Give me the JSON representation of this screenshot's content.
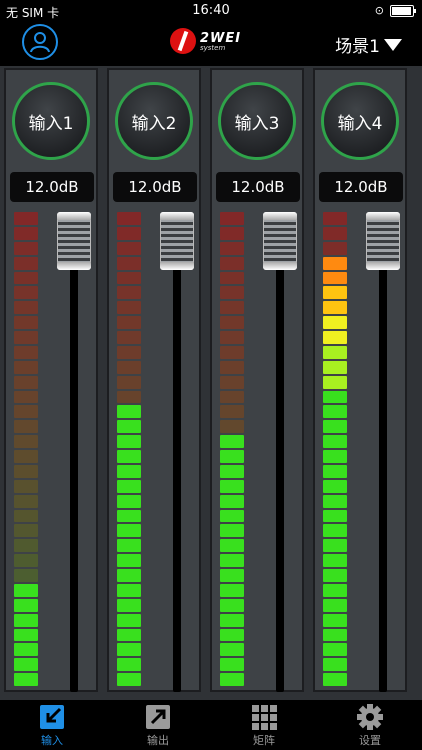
{
  "status": {
    "carrier": "无 SIM 卡",
    "time": "16:40"
  },
  "header": {
    "logo_text": "2WEI",
    "logo_sub": "system",
    "scene_label": "场景1"
  },
  "channels": [
    {
      "name": "输入1",
      "gain": "12.0dB",
      "lit": 7
    },
    {
      "name": "输入2",
      "gain": "12.0dB",
      "lit": 19
    },
    {
      "name": "输入3",
      "gain": "12.0dB",
      "lit": 17
    },
    {
      "name": "输入4",
      "gain": "12.0dB",
      "lit": 29
    }
  ],
  "meter": {
    "segments": 32
  },
  "tabs": [
    {
      "label": "输入",
      "icon": "input-icon",
      "active": true
    },
    {
      "label": "输出",
      "icon": "output-icon",
      "active": false
    },
    {
      "label": "矩阵",
      "icon": "matrix-icon",
      "active": false
    },
    {
      "label": "设置",
      "icon": "settings-gear-icon",
      "active": false
    }
  ],
  "colors": {
    "accent": "#1f8fe6",
    "ring": "#2fa44a",
    "meter_green": "#39e01e"
  }
}
